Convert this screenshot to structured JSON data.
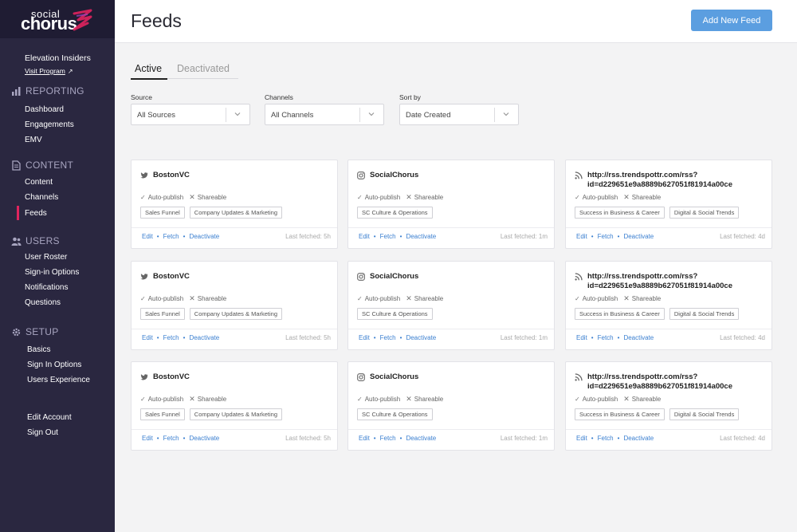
{
  "brand": {
    "logo_top": "social",
    "logo_bottom": "chorus",
    "accent": "#e0245e"
  },
  "program": {
    "name": "Elevation Insiders",
    "visit_label": "Visit Program"
  },
  "sidebar": {
    "reporting": {
      "label": "REPORTING",
      "items": [
        "Dashboard",
        "Engagements",
        "EMV"
      ]
    },
    "content": {
      "label": "CONTENT",
      "items": [
        "Content",
        "Channels",
        "Feeds"
      ]
    },
    "users": {
      "label": "USERS",
      "items": [
        "User Roster",
        "Sign-in Options",
        "Notifications",
        "Questions"
      ]
    },
    "setup": {
      "label": "SETUP",
      "items": [
        "Basics",
        "Sign In Options",
        "Users Experience"
      ]
    },
    "account": [
      "Edit Account",
      "Sign Out"
    ]
  },
  "header": {
    "title": "Feeds",
    "add_button": "Add New Feed"
  },
  "tabs": [
    "Active",
    "Deactivated"
  ],
  "filters": [
    {
      "label": "Source",
      "value": "All Sources"
    },
    {
      "label": "Channels",
      "value": "All Channels"
    },
    {
      "label": "Sort by",
      "value": "Date Created"
    }
  ],
  "card_labels": {
    "auto_publish": "Auto-publish",
    "shareable": "Shareable",
    "edit": "Edit",
    "fetch": "Fetch",
    "deactivate": "Deactivate"
  },
  "feeds": [
    {
      "source": "twitter",
      "title": "BostonVC",
      "tags": [
        "Sales Funnel",
        "Company Updates & Marketing"
      ],
      "fetched": "Last fetched: 5h"
    },
    {
      "source": "instagram",
      "title": "SocialChorus",
      "tags": [
        "SC Culture & Operations"
      ],
      "fetched": "Last fetched: 1m"
    },
    {
      "source": "rss",
      "title": "http://rss.trendspottr.com/rss?id=d229651e9a8889b627051f81914a00ce",
      "tags": [
        "Success in Business & Career",
        "Digital & Social Trends"
      ],
      "fetched": "Last fetched: 4d"
    },
    {
      "source": "twitter",
      "title": "BostonVC",
      "tags": [
        "Sales Funnel",
        "Company Updates & Marketing"
      ],
      "fetched": "Last fetched: 5h"
    },
    {
      "source": "instagram",
      "title": "SocialChorus",
      "tags": [
        "SC Culture & Operations"
      ],
      "fetched": "Last fetched: 1m"
    },
    {
      "source": "rss",
      "title": "http://rss.trendspottr.com/rss?id=d229651e9a8889b627051f81914a00ce",
      "tags": [
        "Success in Business & Career",
        "Digital & Social Trends"
      ],
      "fetched": "Last fetched: 4d"
    },
    {
      "source": "twitter",
      "title": "BostonVC",
      "tags": [
        "Sales Funnel",
        "Company Updates & Marketing"
      ],
      "fetched": "Last fetched: 5h"
    },
    {
      "source": "instagram",
      "title": "SocialChorus",
      "tags": [
        "SC Culture & Operations"
      ],
      "fetched": "Last fetched: 1m"
    },
    {
      "source": "rss",
      "title": "http://rss.trendspottr.com/rss?id=d229651e9a8889b627051f81914a00ce",
      "tags": [
        "Success in Business & Career",
        "Digital & Social Trends"
      ],
      "fetched": "Last fetched: 4d"
    }
  ]
}
